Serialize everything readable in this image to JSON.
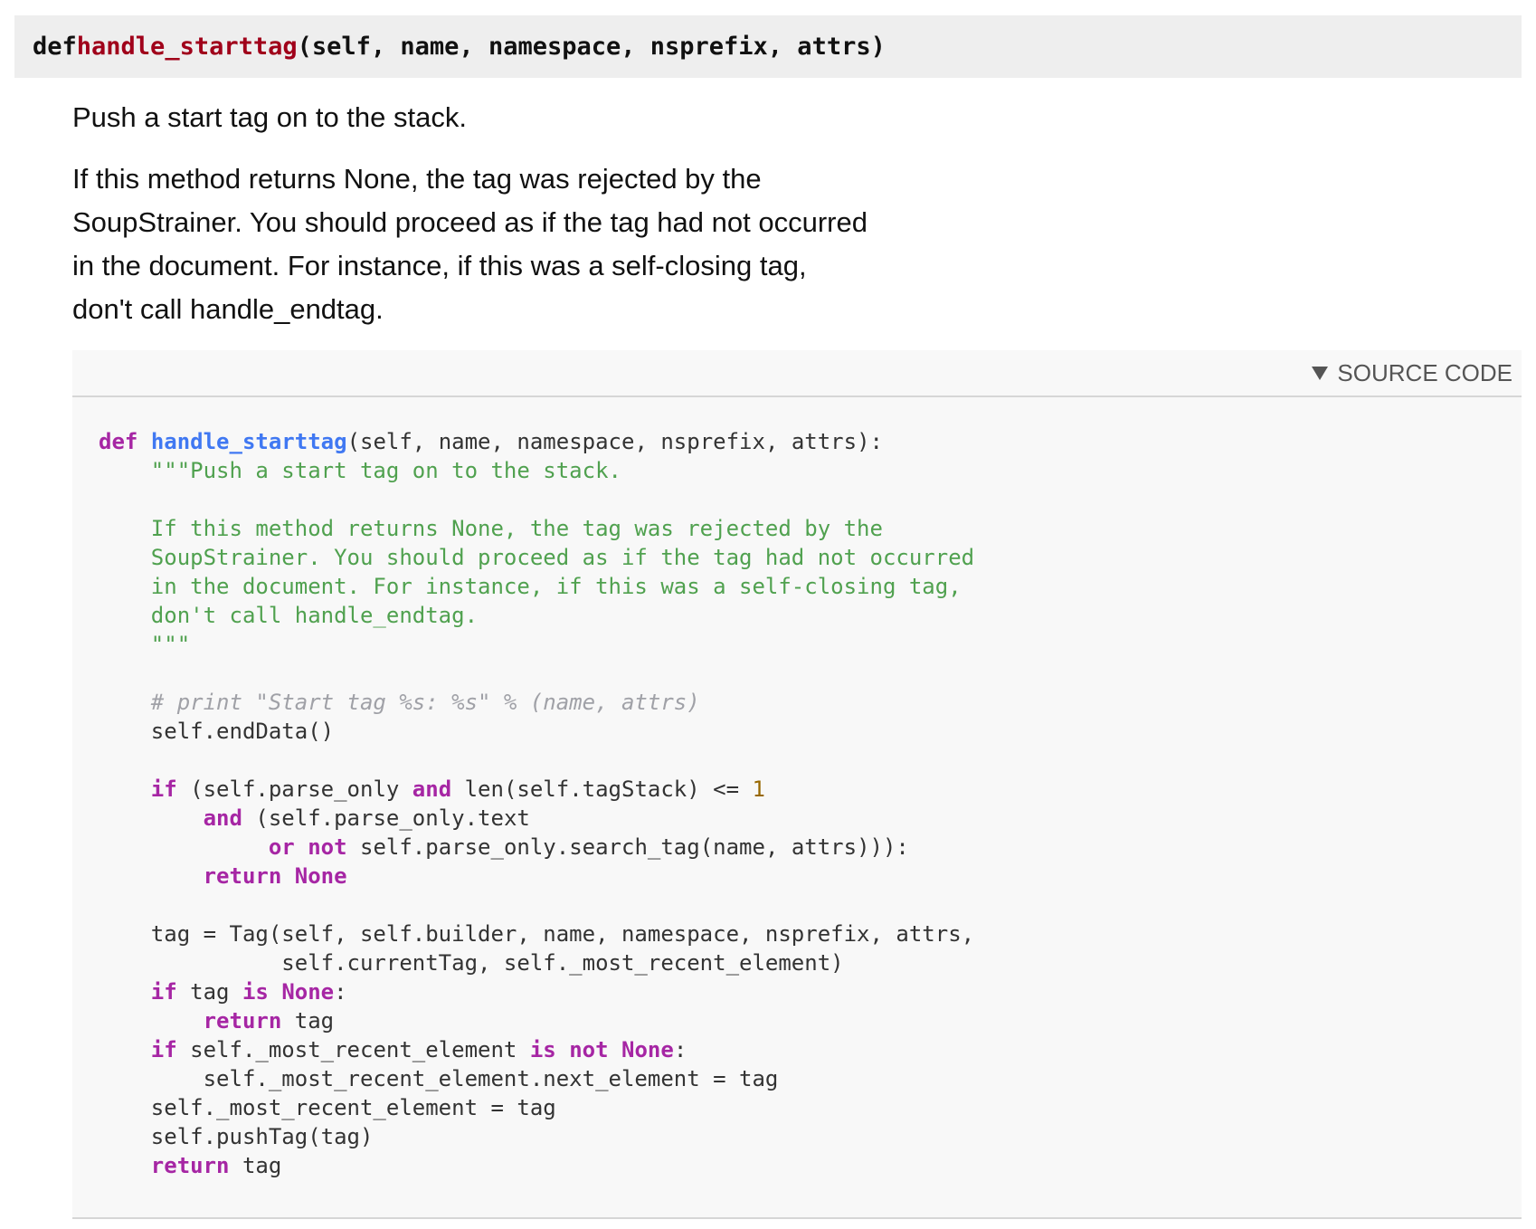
{
  "signature": {
    "keyword": "def",
    "name": "handle_starttag",
    "params": "(self, name, namespace, nsprefix, attrs)"
  },
  "docstring": {
    "summary": "Push a start tag on to the stack.",
    "details_lines": [
      "If this method returns None, the tag was rejected by the",
      "SoupStrainer. You should proceed as if the tag had not occurred",
      "in the document. For instance, if this was a self-closing tag,",
      "don't call handle_endtag."
    ]
  },
  "source": {
    "toggle_label": "SOURCE CODE",
    "toggle_icon": "triangle-down-icon",
    "language": "python"
  },
  "colors": {
    "signature_bg": "#eeeeee",
    "signature_name": "#a0001a",
    "code_bg": "#f8f8f8",
    "keyword": "#a626a4",
    "function": "#4078f2",
    "string": "#50a14f",
    "comment": "#a0a1a7",
    "number": "#986801"
  }
}
